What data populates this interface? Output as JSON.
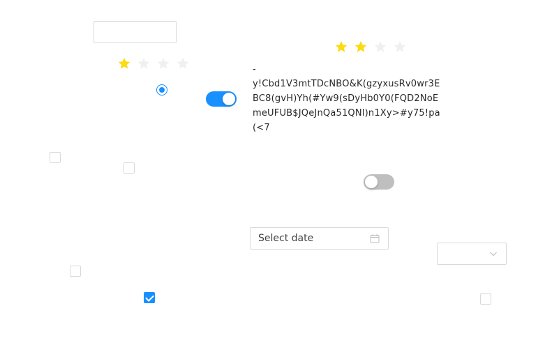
{
  "text_input": {
    "value": "",
    "placeholder": ""
  },
  "rating_left": {
    "value": 1,
    "max": 4
  },
  "rating_right": {
    "value": 2,
    "max": 4
  },
  "radio": {
    "checked": true
  },
  "switch_on": {
    "on": true
  },
  "switch_off": {
    "on": false
  },
  "paragraph": {
    "text": "-\ny!Cbd1V3mtTDcNBO&K(gzyxusRv0wr3EBC8(gvH)Yh(#Yw9(sDyHb0Y0(FQD2NoEmeUFUB$JQeJnQa51QNl)n1Xy>#y75!pa(<7"
  },
  "checkboxes": [
    {
      "checked": false
    },
    {
      "checked": false
    },
    {
      "checked": false
    },
    {
      "checked": true
    },
    {
      "checked": false
    }
  ],
  "date_picker": {
    "placeholder": "Select date",
    "icon": "calendar-icon"
  },
  "select": {
    "value": "",
    "icon": "chevron-down-icon"
  },
  "colors": {
    "primary": "#1890ff",
    "star_active": "#fadb14",
    "star_inactive": "#f0f0f0",
    "switch_off": "#bfbfbf",
    "border": "#d9d9d9"
  }
}
